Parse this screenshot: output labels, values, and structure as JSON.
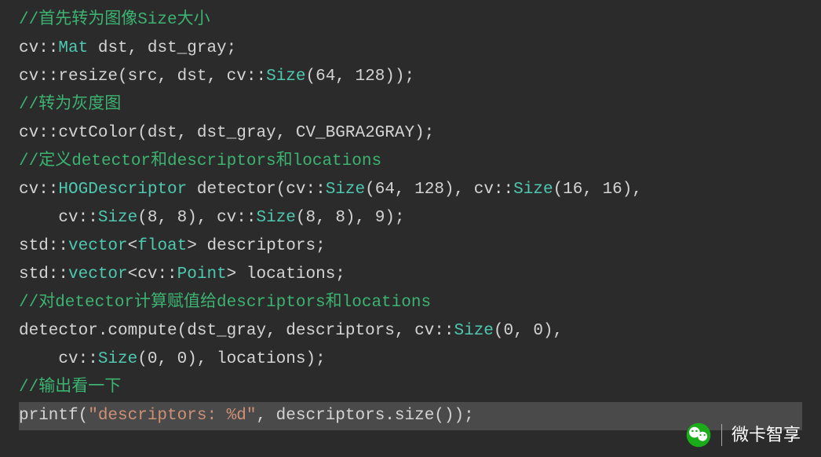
{
  "lines": [
    {
      "segments": [
        {
          "class": "comment",
          "text": "//首先转为图像Size大小"
        }
      ]
    },
    {
      "segments": [
        {
          "class": "normal",
          "text": "cv::"
        },
        {
          "class": "type",
          "text": "Mat"
        },
        {
          "class": "normal",
          "text": " dst, dst_gray;"
        }
      ]
    },
    {
      "segments": [
        {
          "class": "normal",
          "text": "cv::resize(src, dst, cv::"
        },
        {
          "class": "type",
          "text": "Size"
        },
        {
          "class": "normal",
          "text": "(64, 128));"
        }
      ]
    },
    {
      "segments": [
        {
          "class": "comment",
          "text": "//转为灰度图"
        }
      ]
    },
    {
      "segments": [
        {
          "class": "normal",
          "text": "cv::cvtColor(dst, dst_gray, CV_BGRA2GRAY);"
        }
      ]
    },
    {
      "segments": [
        {
          "class": "comment",
          "text": "//定义detector和descriptors和locations"
        }
      ]
    },
    {
      "segments": [
        {
          "class": "normal",
          "text": "cv::"
        },
        {
          "class": "type",
          "text": "HOGDescriptor"
        },
        {
          "class": "normal",
          "text": " detector(cv::"
        },
        {
          "class": "type",
          "text": "Size"
        },
        {
          "class": "normal",
          "text": "(64, 128), cv::"
        },
        {
          "class": "type",
          "text": "Size"
        },
        {
          "class": "normal",
          "text": "(16, 16),"
        }
      ]
    },
    {
      "segments": [
        {
          "class": "normal",
          "text": "    cv::"
        },
        {
          "class": "type",
          "text": "Size"
        },
        {
          "class": "normal",
          "text": "(8, 8), cv::"
        },
        {
          "class": "type",
          "text": "Size"
        },
        {
          "class": "normal",
          "text": "(8, 8), 9);"
        }
      ]
    },
    {
      "segments": [
        {
          "class": "normal",
          "text": "std::"
        },
        {
          "class": "type",
          "text": "vector"
        },
        {
          "class": "normal",
          "text": "<"
        },
        {
          "class": "type",
          "text": "float"
        },
        {
          "class": "normal",
          "text": "> descriptors;"
        }
      ]
    },
    {
      "segments": [
        {
          "class": "normal",
          "text": "std::"
        },
        {
          "class": "type",
          "text": "vector"
        },
        {
          "class": "normal",
          "text": "<cv::"
        },
        {
          "class": "type",
          "text": "Point"
        },
        {
          "class": "normal",
          "text": "> locations;"
        }
      ]
    },
    {
      "segments": [
        {
          "class": "comment",
          "text": "//对detector计算赋值给descriptors和locations"
        }
      ]
    },
    {
      "segments": [
        {
          "class": "normal",
          "text": "detector.compute(dst_gray, descriptors, cv::"
        },
        {
          "class": "type",
          "text": "Size"
        },
        {
          "class": "normal",
          "text": "(0, 0),"
        }
      ]
    },
    {
      "segments": [
        {
          "class": "normal",
          "text": "    cv::"
        },
        {
          "class": "type",
          "text": "Size"
        },
        {
          "class": "normal",
          "text": "(0, 0), locations);"
        }
      ]
    },
    {
      "segments": [
        {
          "class": "comment",
          "text": "//输出看一下"
        }
      ]
    },
    {
      "highlight": true,
      "segments": [
        {
          "class": "normal",
          "text": "printf("
        },
        {
          "class": "str",
          "text": "\"descriptors: %d\""
        },
        {
          "class": "normal",
          "text": ", descriptors.size());"
        }
      ]
    }
  ],
  "watermark": {
    "label": "微卡智享"
  }
}
